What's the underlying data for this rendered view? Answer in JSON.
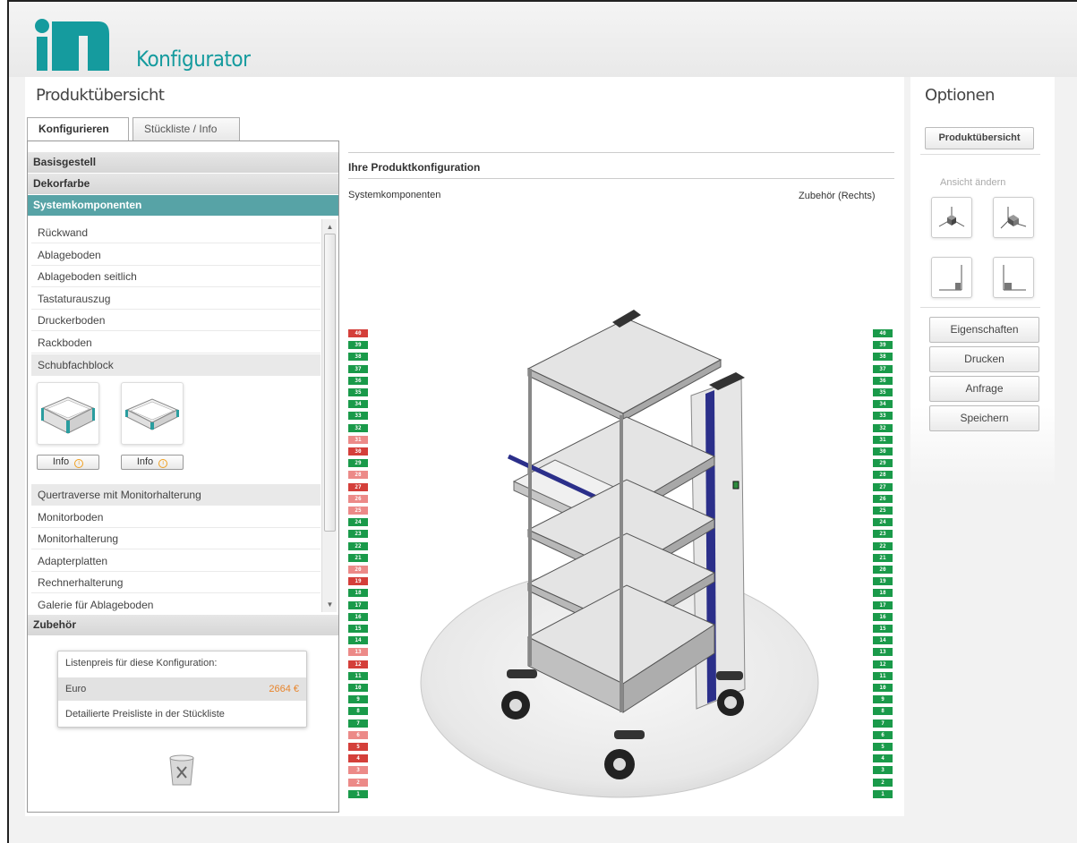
{
  "app": {
    "title": "Konfigurator",
    "brand": "iTD",
    "accent": "#159b9e"
  },
  "left": {
    "title": "Produktübersicht",
    "tabs": [
      {
        "label": "Konfigurieren",
        "active": true
      },
      {
        "label": "Stückliste / Info",
        "active": false
      }
    ],
    "sections": {
      "basisgestell": "Basisgestell",
      "dekorfarbe": "Dekorfarbe",
      "systemkomponenten": "Systemkomponenten",
      "zubehoer": "Zubehör"
    },
    "items": [
      "Rückwand",
      "Ablageboden",
      "Ablageboden seitlich",
      "Tastaturauszug",
      "Druckerboden",
      "Rackboden",
      "Schubfachblock",
      "Quertraverse mit Monitorhalterung",
      "Monitorboden",
      "Monitorhalterung",
      "Adapterplatten",
      "Rechnerhalterung",
      "Galerie für Ablageboden"
    ],
    "info_label": "Info",
    "price": {
      "header": "Listenpreis für diese Konfiguration:",
      "currency": "Euro",
      "value": "2664 €",
      "note": "Detailierte Preisliste in der Stückliste"
    }
  },
  "main": {
    "heading": "Ihre Produktkonfiguration",
    "left_label": "Systemkomponenten",
    "right_label": "Zubehör (Rechts)",
    "left_slots": [
      {
        "n": "40",
        "s": "r"
      },
      {
        "n": "39",
        "s": "g"
      },
      {
        "n": "38",
        "s": "g"
      },
      {
        "n": "37",
        "s": "g"
      },
      {
        "n": "36",
        "s": "g"
      },
      {
        "n": "35",
        "s": "g"
      },
      {
        "n": "34",
        "s": "g"
      },
      {
        "n": "33",
        "s": "g"
      },
      {
        "n": "32",
        "s": "g"
      },
      {
        "n": "31",
        "s": "p"
      },
      {
        "n": "30",
        "s": "r"
      },
      {
        "n": "29",
        "s": "g"
      },
      {
        "n": "28",
        "s": "p"
      },
      {
        "n": "27",
        "s": "r"
      },
      {
        "n": "26",
        "s": "p"
      },
      {
        "n": "25",
        "s": "p"
      },
      {
        "n": "24",
        "s": "g"
      },
      {
        "n": "23",
        "s": "g"
      },
      {
        "n": "22",
        "s": "g"
      },
      {
        "n": "21",
        "s": "g"
      },
      {
        "n": "20",
        "s": "p"
      },
      {
        "n": "19",
        "s": "r"
      },
      {
        "n": "18",
        "s": "g"
      },
      {
        "n": "17",
        "s": "g"
      },
      {
        "n": "16",
        "s": "g"
      },
      {
        "n": "15",
        "s": "g"
      },
      {
        "n": "14",
        "s": "g"
      },
      {
        "n": "13",
        "s": "p"
      },
      {
        "n": "12",
        "s": "r"
      },
      {
        "n": "11",
        "s": "g"
      },
      {
        "n": "10",
        "s": "g"
      },
      {
        "n": "9",
        "s": "g"
      },
      {
        "n": "8",
        "s": "g"
      },
      {
        "n": "7",
        "s": "g"
      },
      {
        "n": "6",
        "s": "p"
      },
      {
        "n": "5",
        "s": "r"
      },
      {
        "n": "4",
        "s": "r"
      },
      {
        "n": "3",
        "s": "p"
      },
      {
        "n": "2",
        "s": "p"
      },
      {
        "n": "1",
        "s": "g"
      }
    ],
    "right_slots": [
      "40",
      "39",
      "38",
      "37",
      "36",
      "35",
      "34",
      "33",
      "32",
      "31",
      "30",
      "29",
      "28",
      "27",
      "26",
      "25",
      "24",
      "23",
      "22",
      "21",
      "20",
      "19",
      "18",
      "17",
      "16",
      "15",
      "14",
      "13",
      "12",
      "11",
      "10",
      "9",
      "8",
      "7",
      "6",
      "5",
      "4",
      "3",
      "2",
      "1"
    ]
  },
  "options": {
    "title": "Optionen",
    "overview_button": "Produktübersicht",
    "view_label": "Ansicht ändern",
    "buttons": [
      "Eigenschaften",
      "Drucken",
      "Anfrage",
      "Speichern"
    ]
  }
}
